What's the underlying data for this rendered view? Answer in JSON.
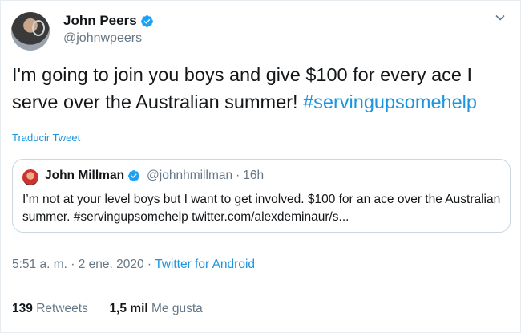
{
  "author": {
    "name": "John Peers",
    "handle": "@johnwpeers"
  },
  "tweet": {
    "text_line1": "I'm going to join you boys and give $100 for every ace I",
    "text_line2": "serve over the Australian summer! ",
    "hashtag": "#servingupsomehelp",
    "translate_label": "Traducir Tweet"
  },
  "quoted": {
    "name": "John Millman",
    "handle": "@johnhmillman",
    "separator": "·",
    "time": "16h",
    "text": "I’m not at your level boys but I want to get involved. $100 for an ace over the Australian summer. #servingupsomehelp twitter.com/alexdeminaur/s..."
  },
  "meta": {
    "timestamp": "5:51 a. m. · 2 ene. 2020",
    "separator": " · ",
    "source": "Twitter for Android"
  },
  "stats": {
    "retweets_count": "139",
    "retweets_label": "Retweets",
    "likes_count": "1,5 mil",
    "likes_label": "Me gusta"
  },
  "colors": {
    "link": "#1b95e0",
    "verified": "#1da1f2",
    "secondary_text": "#657786"
  },
  "icons": {
    "verified": "verified-badge-icon",
    "menu": "chevron-down-icon"
  }
}
